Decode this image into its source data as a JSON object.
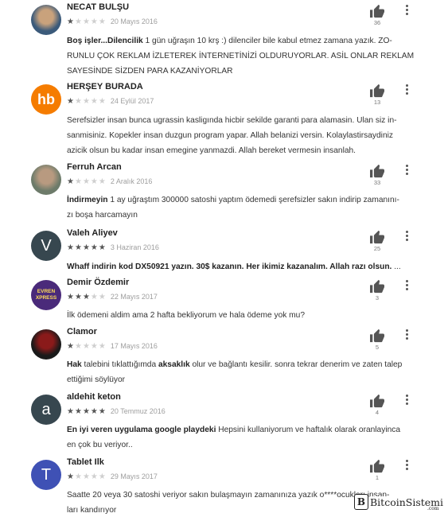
{
  "reviews": [
    {
      "name": "NECAT BULŞU",
      "date": "20 Mayıs 2016",
      "rating": 1,
      "likes": "36",
      "avatar": {
        "type": "photo",
        "colors": [
          "#3b5a7a",
          "#c9a27c"
        ]
      },
      "body_lines": [
        [
          {
            "b": true,
            "t": "Boş işler...Dilencilik"
          },
          {
            "b": false,
            "t": " 1 gün uğraşın 10 krş :) dilenciler bile kabul etmez zamana yazık. ZO-"
          }
        ],
        [
          {
            "b": false,
            "t": "RUNLU ÇOK REKLAM İZLETEREK İNTERNETİNİZİ OLDURUYORLAR. ASİL ONLAR REKLAM"
          }
        ],
        [
          {
            "b": false,
            "t": "SAYESİNDE SİZDEN PARA KAZANİYORLAR"
          }
        ]
      ]
    },
    {
      "name": "HERŞEY BURADA",
      "date": "24 Eylül 2017",
      "rating": 1,
      "likes": "13",
      "avatar": {
        "type": "text",
        "text": "hb",
        "bg": "#f57c00"
      },
      "body_lines": [
        [
          {
            "b": false,
            "t": "Serefsizler insan bunca ugrassin kasligında hicbir sekilde garanti para alamasin. Ulan siz in-"
          }
        ],
        [
          {
            "b": false,
            "t": "sanmisiniz. Kopekler insan duzgun program yapar. Allah belanizi versin. Kolaylastirsaydiniz"
          }
        ],
        [
          {
            "b": false,
            "t": "azicik olsun bu kadar insan emegine yanmazdi. Allah bereket vermesin insanlah."
          }
        ]
      ]
    },
    {
      "name": "Ferruh Arcan",
      "date": "2 Aralık 2016",
      "rating": 1,
      "likes": "33",
      "avatar": {
        "type": "photo",
        "colors": [
          "#6d7b6a",
          "#b89a80"
        ]
      },
      "body_lines": [
        [
          {
            "b": true,
            "t": "İndirmeyin"
          },
          {
            "b": false,
            "t": " 1 ay uğraştım 300000 satoshi yaptım ödemedi şerefsizler sakın indirip zamanını-"
          }
        ],
        [
          {
            "b": false,
            "t": "zı boşa harcamayın"
          }
        ]
      ]
    },
    {
      "name": "Valeh Aliyev",
      "date": "3 Haziran 2016",
      "rating": 5,
      "likes": "25",
      "avatar": {
        "type": "text",
        "text": "V",
        "bg": "#37474f"
      },
      "body_lines": [
        [
          {
            "b": true,
            "t": "Whaff indirin kod DX50921 yazın. 30$ kazanın. Her ikimiz kazanalım. Allah razı olsun."
          },
          {
            "b": false,
            "t": " ..."
          }
        ]
      ]
    },
    {
      "name": "Demir Özdemir",
      "date": "22 Mayıs 2017",
      "rating": 3,
      "likes": "3",
      "avatar": {
        "type": "logo",
        "text": "EVREN XPRESS",
        "bg": "#4a2a7a"
      },
      "body_lines": [
        [
          {
            "b": false,
            "t": "İlk ödemeni aldim ama 2 hafta bekliyorum ve hala ödeme yok mu?"
          }
        ]
      ]
    },
    {
      "name": "Clamor",
      "date": "17 Mayıs 2016",
      "rating": 1,
      "likes": "5",
      "avatar": {
        "type": "photo",
        "colors": [
          "#1a1a1a",
          "#8a1a1a"
        ]
      },
      "body_lines": [
        [
          {
            "b": true,
            "t": "Hak"
          },
          {
            "b": false,
            "t": " talebini tıklattığımda "
          },
          {
            "b": true,
            "t": "aksaklık"
          },
          {
            "b": false,
            "t": " olur ve bağlantı kesilir. sonra tekrar denerim ve zaten talep"
          }
        ],
        [
          {
            "b": false,
            "t": "ettiğimi söylüyor"
          }
        ]
      ]
    },
    {
      "name": "aldehit keton",
      "date": "20 Temmuz 2016",
      "rating": 5,
      "likes": "4",
      "avatar": {
        "type": "text",
        "text": "a",
        "bg": "#37474f"
      },
      "body_lines": [
        [
          {
            "b": true,
            "t": "En iyi veren uygulama google playdeki"
          },
          {
            "b": false,
            "t": " Hepsini kullaniyorum ve haftalık olarak oranlayinca"
          }
        ],
        [
          {
            "b": false,
            "t": "en çok bu veriyor.."
          }
        ]
      ]
    },
    {
      "name": "Tablet Ilk",
      "date": "29 Mayıs 2017",
      "rating": 1,
      "likes": "1",
      "avatar": {
        "type": "text",
        "text": "T",
        "bg": "#3f51b5"
      },
      "body_lines": [
        [
          {
            "b": false,
            "t": "Saatte 20 veya 30 satoshi veriyor sakın bulaşmayın zamanınıza yazık o****ocukları insan-"
          }
        ],
        [
          {
            "b": false,
            "t": "ları kandırıyor"
          }
        ]
      ]
    }
  ],
  "watermark": {
    "logo": "B",
    "text": "BitcoinSistemi",
    "sub": ".com"
  }
}
